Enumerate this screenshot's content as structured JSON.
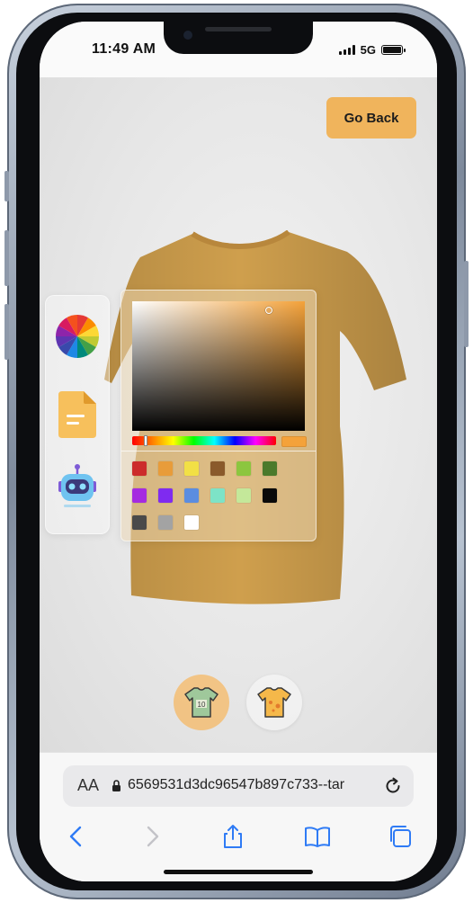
{
  "status_bar": {
    "time": "11:49 AM",
    "network": "5G"
  },
  "header": {
    "go_back_label": "Go Back"
  },
  "shirt": {
    "color": "#cf9f4d"
  },
  "toolbar": {
    "items": [
      {
        "name": "color-wheel",
        "icon": "color-wheel-icon"
      },
      {
        "name": "file",
        "icon": "file-icon"
      },
      {
        "name": "ai-bot",
        "icon": "robot-icon"
      }
    ]
  },
  "color_picker": {
    "selected_color": "#f4a23a",
    "swatches": [
      "#cc2b2b",
      "#e89c3a",
      "#f2e045",
      "#8a5a2b",
      "#8cc63f",
      "#4b7a2b",
      "#a52be0",
      "#7f2bf0",
      "#5b8de0",
      "#7de3c7",
      "#c4e89a",
      "#0a0a0a",
      "#4a4a4a",
      "#a3a3a3",
      "#ffffff"
    ]
  },
  "tabs": [
    {
      "name": "logo-shirt",
      "icon": "logo-shirt-icon",
      "active": true
    },
    {
      "name": "stylish-shirt",
      "icon": "stylish-shirt-icon",
      "active": false
    }
  ],
  "browser": {
    "aa_label": "AA",
    "url": "6569531d3dc96547b897c733--tar"
  }
}
